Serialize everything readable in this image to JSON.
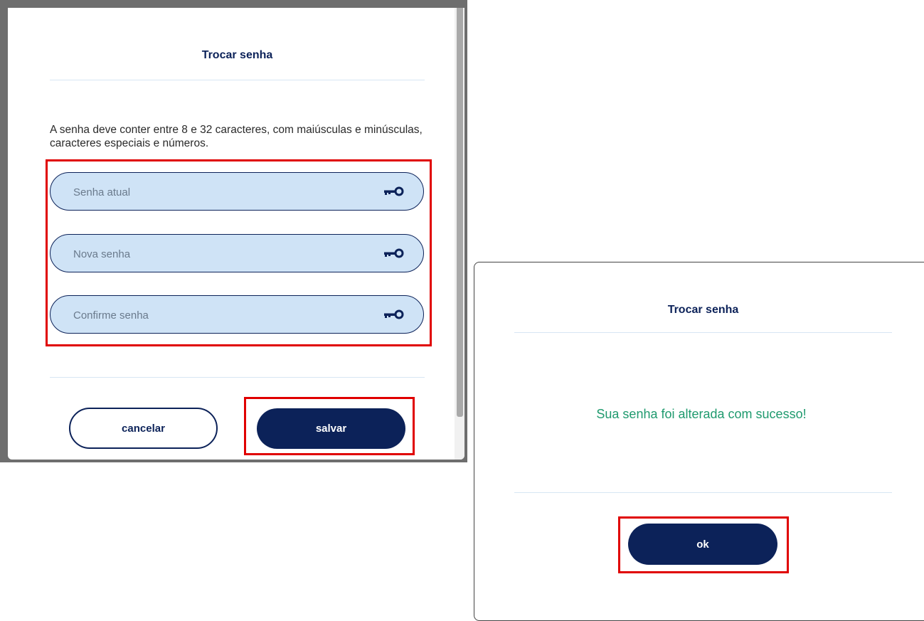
{
  "change_password_dialog": {
    "title": "Trocar senha",
    "instructions": "A senha deve conter entre 8 e 32 caracteres, com maiúsculas e minúsculas, caracteres especiais e números.",
    "fields": [
      {
        "placeholder": "Senha atual",
        "icon": "key-icon"
      },
      {
        "placeholder": "Nova senha",
        "icon": "key-icon"
      },
      {
        "placeholder": "Confirme senha",
        "icon": "key-icon"
      }
    ],
    "cancel_label": "cancelar",
    "save_label": "salvar"
  },
  "success_dialog": {
    "title": "Trocar senha",
    "message": "Sua senha foi alterada com sucesso!",
    "ok_label": "ok"
  },
  "colors": {
    "primary": "#0c2259",
    "field_background": "#cfe3f6",
    "success_text": "#1f9a6e",
    "highlight": "#e00000"
  }
}
